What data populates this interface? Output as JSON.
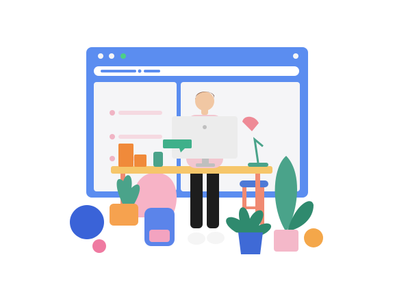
{
  "illustration": {
    "colors": {
      "window_frame": "#5b8df0",
      "window_panel": "#f5f5f7",
      "address_bar": "#ffffff",
      "address_fill": "#5b8df0",
      "dot_green": "#4ccf86",
      "desk_top": "#f6c66a",
      "desk_leg": "#f08a72",
      "monitor": "#ececec",
      "monitor_dark": "#bfbfbf",
      "speech_bubble": "#3fb08a",
      "lamp_pink": "#ee8a96",
      "lamp_base": "#4aa38a",
      "stool_seat": "#4e79d6",
      "stool_legs": "#f08a72",
      "person_shirt": "#f2c6cf",
      "person_skin": "#f1c7a3",
      "person_hair": "#7a4f3a",
      "person_pants": "#1d1d1d",
      "person_shoes": "#f5f5f5",
      "ball_blue": "#3a63d8",
      "ball_pink": "#ef7aa1",
      "ball_orange": "#f4a74a",
      "plant_green": "#4aa38a",
      "plant_green_dark": "#2f8a6e",
      "pot_orange": "#f6a24f",
      "pot_blue": "#3f6ad6",
      "pot_pink": "#f4b8c9",
      "backpack": "#5b84ea",
      "backpack_pocket": "#f3a3c0",
      "frame_orange": "#f08a3a",
      "blob_pink": "#f7b3c6",
      "list_dot": "#f0b4c4",
      "list_line": "#f5d9e1"
    }
  }
}
